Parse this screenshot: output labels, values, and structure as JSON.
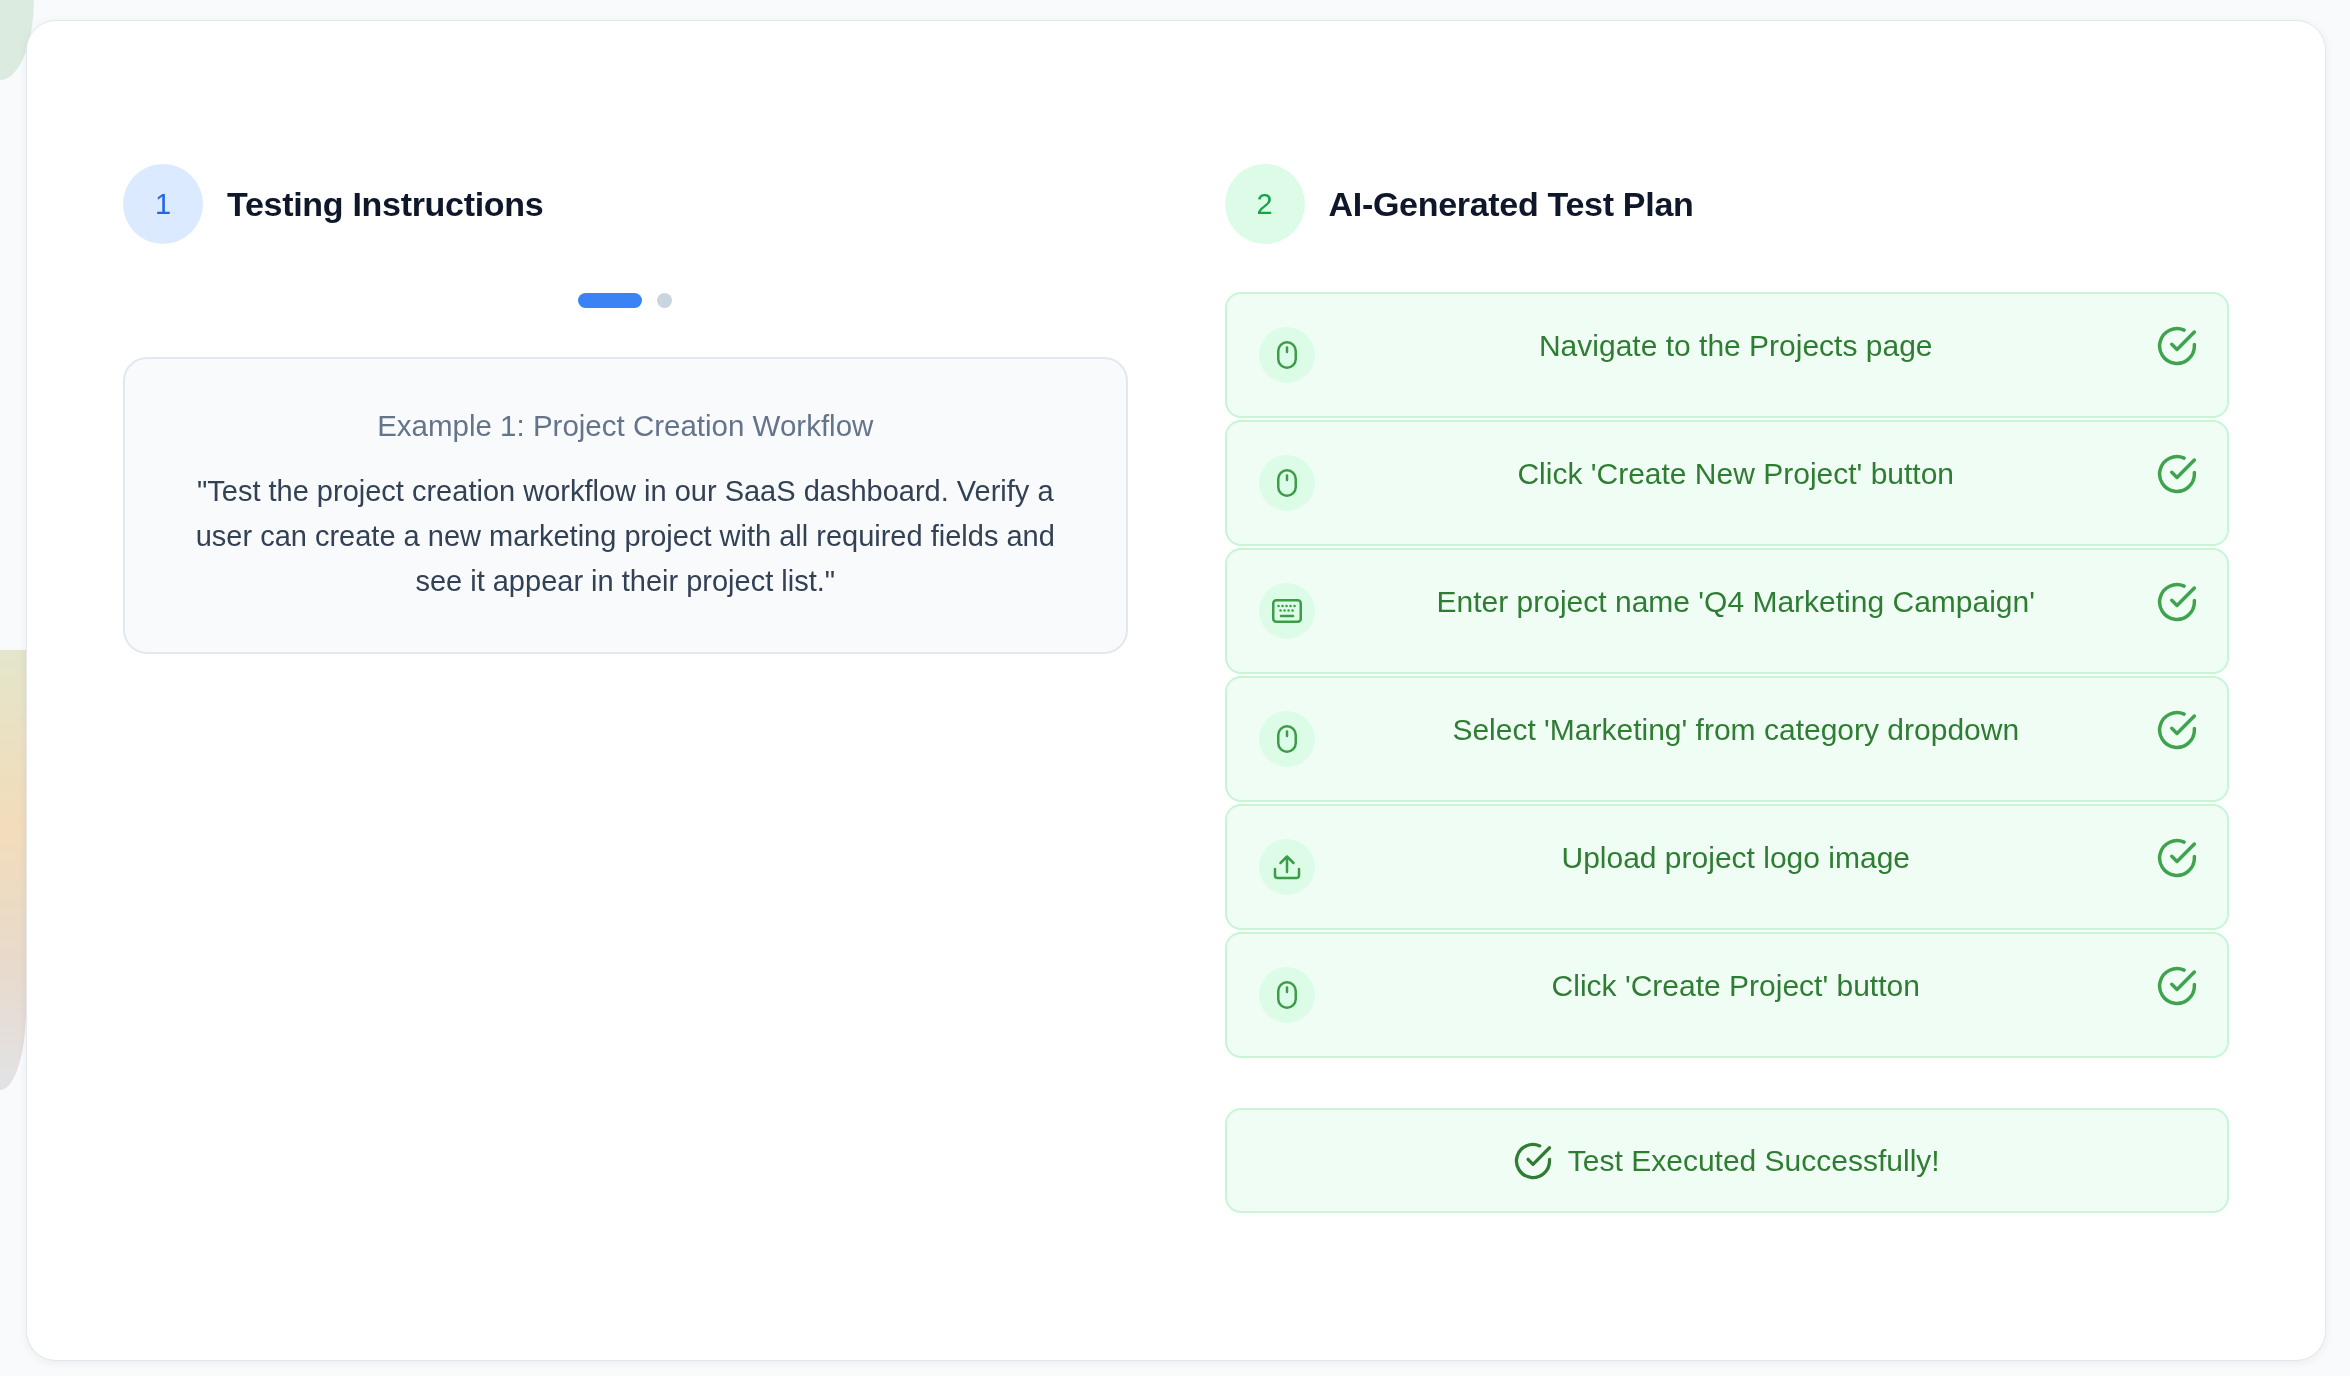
{
  "instructions": {
    "step_number": "1",
    "title": "Testing Instructions",
    "carousel_dots": [
      {
        "selected": true
      },
      {
        "selected": false
      }
    ],
    "example": {
      "title": "Example 1: Project Creation Workflow",
      "text": "\"Test the project creation workflow in our SaaS dashboard. Verify a user can create a new marketing project with all required fields and see it appear in their project list.\""
    }
  },
  "test_plan": {
    "step_number": "2",
    "title": "AI-Generated Test Plan",
    "steps": [
      {
        "kind": "click",
        "text": "Navigate to the Projects page",
        "done": true
      },
      {
        "kind": "click",
        "text": "Click 'Create New Project' button",
        "done": true
      },
      {
        "kind": "type",
        "text": "Enter project name 'Q4 Marketing Campaign'",
        "done": true
      },
      {
        "kind": "click",
        "text": "Select 'Marketing' from category dropdown",
        "done": true
      },
      {
        "kind": "upload",
        "text": "Upload project logo image",
        "done": true
      },
      {
        "kind": "click",
        "text": "Click 'Create Project' button",
        "done": true
      }
    ],
    "result": {
      "kind": "success",
      "text": "Test Executed Successfully!"
    }
  }
}
